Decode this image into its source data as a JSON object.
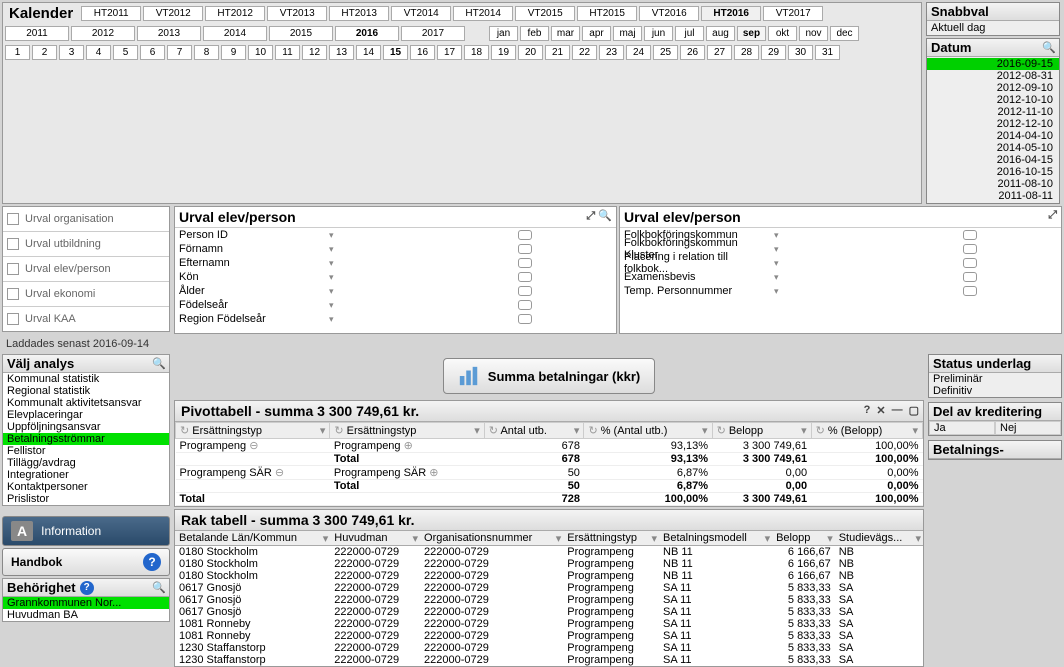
{
  "calendar": {
    "title": "Kalender",
    "terms": [
      "HT2011",
      "VT2012",
      "HT2012",
      "VT2013",
      "HT2013",
      "VT2014",
      "HT2014",
      "VT2015",
      "HT2015",
      "VT2016",
      "HT2016",
      "VT2017"
    ],
    "term_selected": "HT2016",
    "years": [
      "2011",
      "2012",
      "2013",
      "2014",
      "2015",
      "2016",
      "2017"
    ],
    "year_selected": "2016",
    "months": [
      "jan",
      "feb",
      "mar",
      "apr",
      "maj",
      "jun",
      "jul",
      "aug",
      "sep",
      "okt",
      "nov",
      "dec"
    ],
    "month_selected": "sep",
    "days": [
      "1",
      "2",
      "3",
      "4",
      "5",
      "6",
      "7",
      "8",
      "9",
      "10",
      "11",
      "12",
      "13",
      "14",
      "15",
      "16",
      "17",
      "18",
      "19",
      "20",
      "21",
      "22",
      "23",
      "24",
      "25",
      "26",
      "27",
      "28",
      "29",
      "30",
      "31"
    ],
    "day_selected": "15"
  },
  "snabbval": {
    "title": "Snabbval",
    "items": [
      "Aktuell dag"
    ]
  },
  "datum": {
    "title": "Datum",
    "items": [
      "2016-09-15",
      "2012-08-31",
      "2012-09-10",
      "2012-10-10",
      "2012-11-10",
      "2012-12-10",
      "2014-04-10",
      "2014-05-10",
      "2016-04-15",
      "2016-10-15",
      "2011-08-10",
      "2011-08-11"
    ],
    "selected": "2016-09-15"
  },
  "nav": {
    "items": [
      "Urval organisation",
      "Urval utbildning",
      "Urval elev/person",
      "Urval ekonomi",
      "Urval KAA"
    ]
  },
  "urval1": {
    "title": "Urval elev/person",
    "fields": [
      "Person ID",
      "Förnamn",
      "Efternamn",
      "Kön",
      "Ålder",
      "Födelseår",
      "Region Födelseår"
    ]
  },
  "urval2": {
    "title": "Urval elev/person",
    "fields": [
      "Folkbokföringskommun",
      "Folkbokföringskommun Kluster",
      "Placering i relation till folkbok...",
      "Examensbevis",
      "Temp. Personnummer"
    ]
  },
  "loaded": "Laddades senast 2016-09-14",
  "analys": {
    "title": "Välj analys",
    "items": [
      "Kommunal statistik",
      "Regional statistik",
      "Kommunalt aktivitetsansvar",
      "Elevplaceringar",
      "Uppföljningsansvar",
      "Betalningsströmmar",
      "Fellistor",
      "Tillägg/avdrag",
      "Integrationer",
      "Kontaktpersoner",
      "Prislistor"
    ],
    "selected": "Betalningsströmmar"
  },
  "summa_btn": "Summa betalningar (kkr)",
  "pivot": {
    "title": "Pivottabell - summa 3 300 749,61 kr.",
    "cols": [
      "Ersättningstyp",
      "Ersättningstyp",
      "Antal utb.",
      "% (Antal utb.)",
      "Belopp",
      "% (Belopp)"
    ],
    "rows": [
      {
        "g": "Programpeng",
        "t": "Programpeng",
        "a": "678",
        "pa": "93,13%",
        "b": "3 300 749,61",
        "pb": "100,00%"
      },
      {
        "g": "",
        "t": "Total",
        "a": "678",
        "pa": "93,13%",
        "b": "3 300 749,61",
        "pb": "100,00%",
        "bold": true
      },
      {
        "g": "Programpeng SÄR",
        "t": "Programpeng SÄR",
        "a": "50",
        "pa": "6,87%",
        "b": "0,00",
        "pb": "0,00%"
      },
      {
        "g": "",
        "t": "Total",
        "a": "50",
        "pa": "6,87%",
        "b": "0,00",
        "pb": "0,00%",
        "bold": true
      },
      {
        "g": "Total",
        "t": "",
        "a": "728",
        "pa": "100,00%",
        "b": "3 300 749,61",
        "pb": "100,00%",
        "bold": true
      }
    ]
  },
  "rak": {
    "title": "Rak tabell - summa 3 300 749,61 kr.",
    "cols": [
      "Betalande Län/Kommun",
      "Huvudman",
      "Organisationsnummer",
      "Ersättningstyp",
      "Betalningsmodell",
      "Belopp",
      "Studievägs..."
    ],
    "rows": [
      {
        "k": "0180 Stockholm",
        "h": "222000-0729",
        "o": "222000-0729",
        "e": "Programpeng",
        "m": "NB  11",
        "b": "6 166,67",
        "s": "NB"
      },
      {
        "k": "0180 Stockholm",
        "h": "222000-0729",
        "o": "222000-0729",
        "e": "Programpeng",
        "m": "NB  11",
        "b": "6 166,67",
        "s": "NB"
      },
      {
        "k": "0180 Stockholm",
        "h": "222000-0729",
        "o": "222000-0729",
        "e": "Programpeng",
        "m": "NB  11",
        "b": "6 166,67",
        "s": "NB"
      },
      {
        "k": "0617 Gnosjö",
        "h": "222000-0729",
        "o": "222000-0729",
        "e": "Programpeng",
        "m": "SA  11",
        "b": "5 833,33",
        "s": "SA"
      },
      {
        "k": "0617 Gnosjö",
        "h": "222000-0729",
        "o": "222000-0729",
        "e": "Programpeng",
        "m": "SA  11",
        "b": "5 833,33",
        "s": "SA"
      },
      {
        "k": "0617 Gnosjö",
        "h": "222000-0729",
        "o": "222000-0729",
        "e": "Programpeng",
        "m": "SA  11",
        "b": "5 833,33",
        "s": "SA"
      },
      {
        "k": "1081 Ronneby",
        "h": "222000-0729",
        "o": "222000-0729",
        "e": "Programpeng",
        "m": "SA  11",
        "b": "5 833,33",
        "s": "SA"
      },
      {
        "k": "1081 Ronneby",
        "h": "222000-0729",
        "o": "222000-0729",
        "e": "Programpeng",
        "m": "SA  11",
        "b": "5 833,33",
        "s": "SA"
      },
      {
        "k": "1230 Staffanstorp",
        "h": "222000-0729",
        "o": "222000-0729",
        "e": "Programpeng",
        "m": "SA  11",
        "b": "5 833,33",
        "s": "SA"
      },
      {
        "k": "1230 Staffanstorp",
        "h": "222000-0729",
        "o": "222000-0729",
        "e": "Programpeng",
        "m": "SA  11",
        "b": "5 833,33",
        "s": "SA"
      }
    ]
  },
  "status": {
    "title": "Status underlag",
    "items": [
      "Preliminär",
      "Definitiv"
    ]
  },
  "delav": {
    "title": "Del av kreditering",
    "ja": "Ja",
    "nej": "Nej"
  },
  "betal": {
    "title": "Betalnings-"
  },
  "info_btn": "Information",
  "handbok_btn": "Handbok",
  "behorighet": {
    "title": "Behörighet",
    "items": [
      "Grannkommunen Nor...",
      "Huvudman BA"
    ],
    "selected": "Grannkommunen Nor..."
  }
}
